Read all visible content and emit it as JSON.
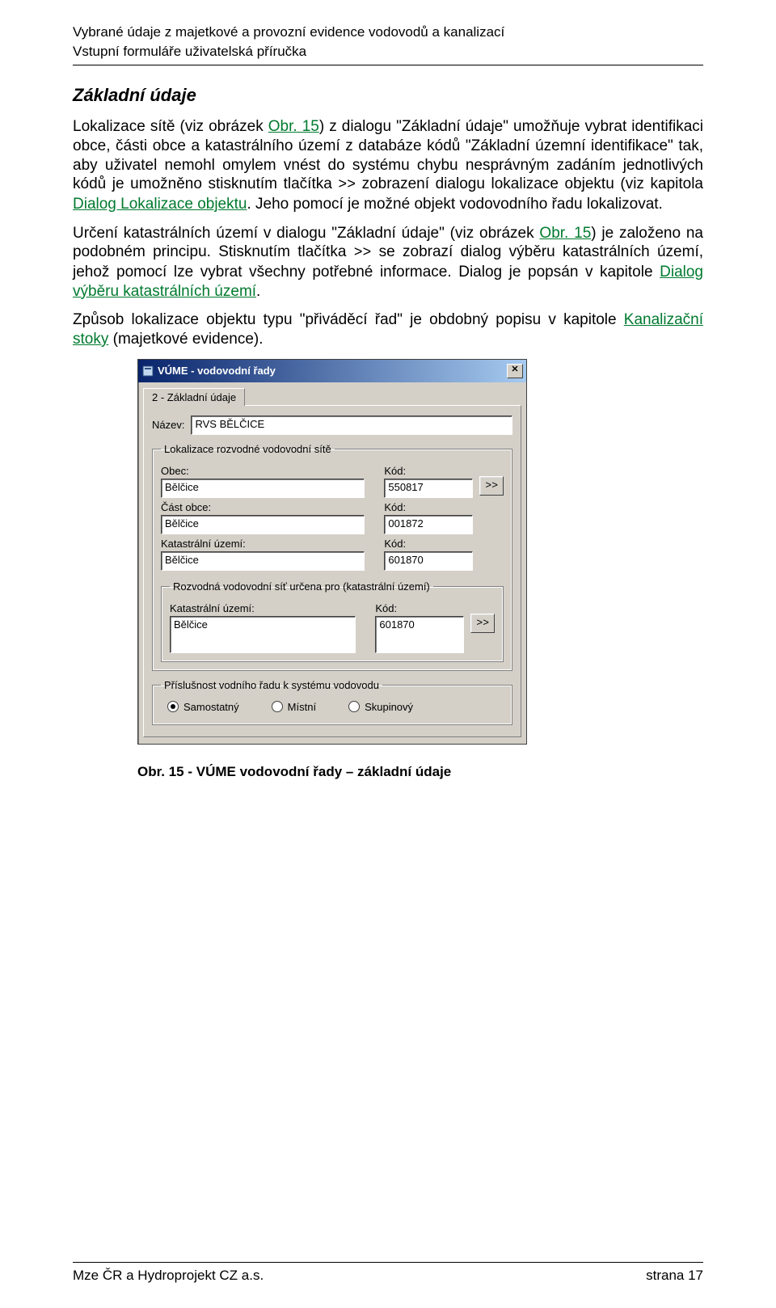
{
  "header": {
    "title": "Vybrané údaje z majetkové a provozní evidence vodovodů a kanalizací",
    "subtitle": "Vstupní formuláře uživatelská příručka"
  },
  "section_title": "Základní údaje",
  "para1": {
    "t1": "Lokalizace sítě (viz obrázek ",
    "link1": "Obr. 15",
    "t2": ") z dialogu \"Základní údaje\" umožňuje vybrat identifikaci obce, části obce a katastrálního území z databáze kódů \"Základní územní identifikace\" tak, aby uživatel nemohl omylem vnést do systému chybu nesprávným zadáním jednotlivých kódů je umožněno stisknutím tlačítka ",
    "btn1": ">>",
    "t3": " zobrazení dialogu lokalizace objektu (viz kapitola ",
    "link2": "Dialog Lokalizace objektu",
    "t4": ". Jeho pomocí je možné objekt vodovodního řadu lokalizovat."
  },
  "para2": {
    "t1": "Určení katastrálních území v dialogu \"Základní údaje\" (viz obrázek ",
    "link1": "Obr. 15",
    "t2": ") je založeno na podobném principu. Stisknutím tlačítka ",
    "btn1": ">>",
    "t3": " se zobrazí dialog výběru katastrálních území, jehož pomocí lze vybrat všechny potřebné informace. Dialog je popsán v kapitole ",
    "link2": "Dialog výběru katastrálních území",
    "t4": "."
  },
  "para3": {
    "t1": "Způsob lokalizace objektu typu \"přiváděcí řad\" je obdobný popisu v kapitole ",
    "link1": "Kanalizační stoky",
    "t2": " (majetkové evidence)."
  },
  "dialog": {
    "title": "VÚME - vodovodní řady",
    "tab": "2 - Základní údaje",
    "name_label": "Název:",
    "name_value": "RVS BĚLČICE",
    "loc_group": "Lokalizace rozvodné vodovodní sítě",
    "obec_label": "Obec:",
    "obec_value": "Bělčice",
    "obec_kod_label": "Kód:",
    "obec_kod_value": "550817",
    "cast_label": "Část obce:",
    "cast_value": "Bělčice",
    "cast_kod_label": "Kód:",
    "cast_kod_value": "001872",
    "ku_label": "Katastrální území:",
    "ku_value": "Bělčice",
    "ku_kod_label": "Kód:",
    "ku_kod_value": "601870",
    "btn_more": ">>",
    "dest_group": "Rozvodná vodovodní síť určena pro (katastrální území)",
    "dest_ku_label": "Katastrální území:",
    "dest_ku_value": "Bělčice",
    "dest_kod_label": "Kód:",
    "dest_kod_value": "601870",
    "sys_group": "Příslušnost vodního řadu k systému vodovodu",
    "radio1": "Samostatný",
    "radio2": "Místní",
    "radio3": "Skupinový"
  },
  "caption": "Obr. 15 - VÚME vodovodní řady – základní údaje",
  "footer": {
    "left": "Mze ČR a Hydroprojekt CZ a.s.",
    "right": "strana 17"
  }
}
